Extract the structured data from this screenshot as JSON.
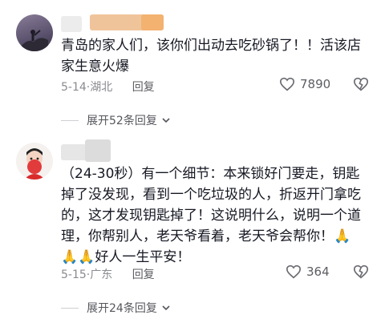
{
  "comments": [
    {
      "text": "青岛的家人们，该你们出动去吃砂锅了！！活该店家生意火爆",
      "date": "5-14",
      "sep": "·",
      "location": "湖北",
      "reply_label": "回复",
      "likes": "7890",
      "expand_label": "展开52条回复"
    },
    {
      "text": "（24-30秒）有一个细节：本来锁好门要走，钥匙掉了没发现，看到一个吃垃圾的人，折返开门拿吃的，这才发现钥匙掉了！这说明什么，说明一个道理，你帮别人，老天爷看着，老天爷会帮你！🙏🙏🙏好人一生平安！",
      "date": "5-15",
      "sep": "·",
      "location": "广东",
      "reply_label": "回复",
      "likes": "364",
      "expand_label": "展开24条回复"
    }
  ],
  "icons": {
    "like": "heart-outline-icon",
    "dislike": "broken-heart-icon",
    "expand": "chevron-down-icon"
  }
}
